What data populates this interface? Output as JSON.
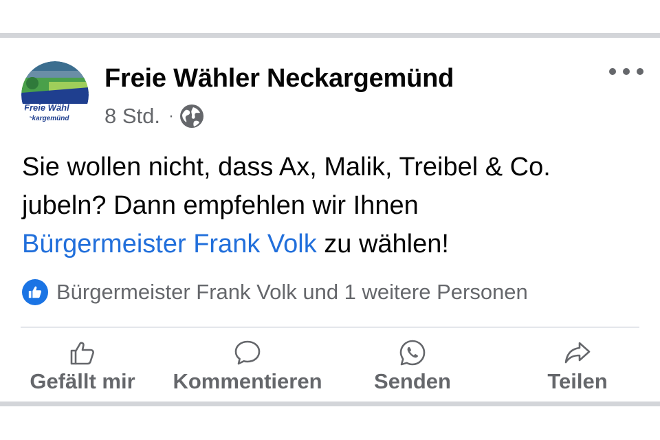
{
  "post": {
    "page_name": "Freie Wähler Neckargemünd",
    "avatar_text_line1": "Freie Wähl",
    "avatar_text_line2": "ckargemünd",
    "time": "8 Std.",
    "separator": "·",
    "audience_icon": "globe-icon",
    "text_line1": "Sie wollen nicht, dass Ax, Malik, Treibel & Co.",
    "text_line2": "jubeln? Dann empfehlen wir Ihnen",
    "mention": "Bürgermeister Frank Volk",
    "text_after_mention": " zu wählen!",
    "reactions_text": "Bürgermeister Frank Volk und 1 weitere Personen"
  },
  "actions": {
    "like": "Gefällt mir",
    "comment": "Kommentieren",
    "send": "Senden",
    "share": "Teilen"
  },
  "colors": {
    "text": "#050505",
    "secondary": "#65676b",
    "link": "#216fdb",
    "like_blue": "#1b74e4",
    "divider": "#d3d5d9"
  }
}
